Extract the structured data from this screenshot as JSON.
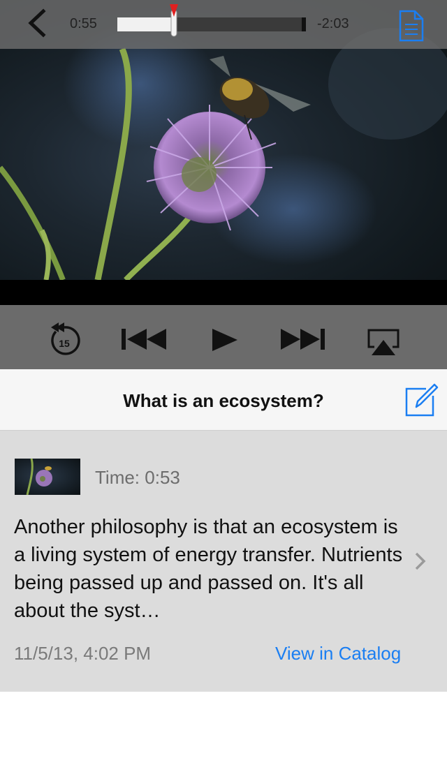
{
  "player": {
    "elapsed": "0:55",
    "remaining": "-2:03",
    "progress": 0.3,
    "skip_back_seconds": "15"
  },
  "note_header": {
    "title": "What is an ecosystem?"
  },
  "note": {
    "time_label": "Time: 0:53",
    "text": "Another philosophy is that an ecosystem is a living system of energy transfer. Nutrients being passed up and passed on. It's all about the syst…",
    "date": "11/5/13, 4:02 PM",
    "catalog_link": "View in Catalog"
  },
  "colors": {
    "accent": "#1a7ef2",
    "scrubber_thumb": "#e02020",
    "controls_bg": "#6b6b6b",
    "note_bg": "#dcdcdc"
  },
  "icons": {
    "back": "chevron-left-icon",
    "transcript": "document-icon",
    "replay": "replay-15-icon",
    "previous": "skip-previous-icon",
    "play": "play-icon",
    "next": "skip-next-icon",
    "airplay": "airplay-icon",
    "edit": "compose-icon",
    "disclosure": "chevron-right-icon"
  }
}
